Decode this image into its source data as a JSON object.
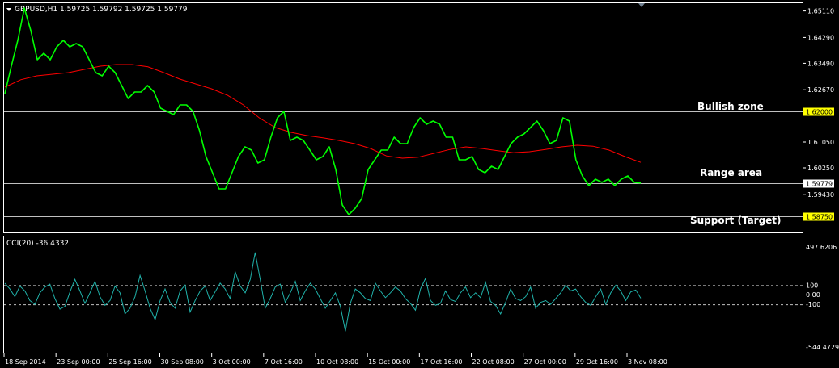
{
  "header": {
    "symbol_line": "GBPUSD,H1  1.59725 1.59792 1.59725 1.59779"
  },
  "annotations": {
    "bullish": "Bullish zone",
    "range": "Range area",
    "support": "Support (Target)"
  },
  "levels": [
    {
      "value": 1.62,
      "label": "1.62000",
      "highlight": true
    },
    {
      "value": 1.59779,
      "label": "1.59779",
      "highlight": false
    },
    {
      "value": 1.5875,
      "label": "1.58750",
      "highlight": true
    }
  ],
  "colors": {
    "background": "#000000",
    "price": "#00FF00",
    "ma": "#FF0000",
    "cci": "#20B2AA",
    "grid_line": "#C0C0C0",
    "level_highlight": "#FFFF00",
    "text": "#FFFFFF"
  },
  "chart_data": [
    {
      "type": "line",
      "title": "GBPUSD,H1",
      "ylim": [
        1.5825,
        1.6535
      ],
      "y_ticks": [
        "1.65110",
        "1.64290",
        "1.63490",
        "1.62670",
        "1.61050",
        "1.60250",
        "1.59430"
      ],
      "x_ticks": [
        "18 Sep 2014",
        "23 Sep 00:00",
        "25 Sep 16:00",
        "30 Sep 08:00",
        "3 Oct 00:00",
        "7 Oct 16:00",
        "10 Oct 08:00",
        "15 Oct 00:00",
        "17 Oct 16:00",
        "22 Oct 08:00",
        "27 Oct 00:00",
        "29 Oct 16:00",
        "3 Nov 08:00"
      ],
      "series": [
        {
          "style": "price",
          "values": [
            1.6255,
            1.634,
            1.642,
            1.652,
            1.645,
            1.636,
            1.638,
            1.636,
            1.64,
            1.642,
            1.64,
            1.641,
            1.64,
            1.636,
            1.632,
            1.631,
            1.634,
            1.632,
            1.628,
            1.624,
            1.626,
            1.626,
            1.628,
            1.626,
            1.621,
            1.62,
            1.619,
            1.622,
            1.622,
            1.62,
            1.614,
            1.606,
            1.601,
            1.596,
            1.596,
            1.601,
            1.606,
            1.609,
            1.608,
            1.604,
            1.605,
            1.612,
            1.618,
            1.62,
            1.611,
            1.612,
            1.611,
            1.608,
            1.605,
            1.606,
            1.609,
            1.602,
            1.591,
            1.588,
            1.59,
            1.593,
            1.602,
            1.605,
            1.608,
            1.608,
            1.612,
            1.61,
            1.61,
            1.615,
            1.618,
            1.616,
            1.617,
            1.616,
            1.612,
            1.612,
            1.605,
            1.605,
            1.606,
            1.602,
            1.601,
            1.603,
            1.602,
            1.606,
            1.61,
            1.612,
            1.613,
            1.615,
            1.617,
            1.614,
            1.61,
            1.611,
            1.618,
            1.617,
            1.605,
            1.6,
            1.597,
            1.599,
            1.598,
            1.599,
            1.597,
            1.599,
            1.6,
            1.598,
            1.5978
          ]
        },
        {
          "style": "ma",
          "values": [
            1.6275,
            1.6298,
            1.631,
            1.6315,
            1.632,
            1.633,
            1.634,
            1.6345,
            1.6345,
            1.6338,
            1.632,
            1.63,
            1.6285,
            1.627,
            1.625,
            1.622,
            1.618,
            1.615,
            1.6135,
            1.6125,
            1.6118,
            1.611,
            1.61,
            1.6085,
            1.6062,
            1.6055,
            1.6058,
            1.607,
            1.6082,
            1.609,
            1.6085,
            1.6078,
            1.6072,
            1.6075,
            1.6082,
            1.609,
            1.6095,
            1.6092,
            1.608,
            1.606,
            1.6042
          ]
        }
      ]
    },
    {
      "type": "line",
      "title": "CCI(20) -36.4332",
      "ylim": [
        -544.4729,
        497.6206
      ],
      "y_ticks": [
        "497.6206",
        "100",
        "0.00",
        "-100",
        "-544.4729"
      ],
      "series": [
        {
          "style": "cci",
          "values": [
            120,
            60,
            -20,
            90,
            40,
            -60,
            -100,
            20,
            80,
            110,
            -40,
            -150,
            -120,
            30,
            160,
            40,
            -90,
            20,
            140,
            -20,
            -110,
            -60,
            90,
            20,
            -200,
            -140,
            -20,
            200,
            40,
            -140,
            -260,
            -60,
            60,
            -80,
            -140,
            40,
            100,
            -180,
            -60,
            40,
            90,
            -60,
            30,
            120,
            60,
            -40,
            240,
            90,
            20,
            160,
            440,
            160,
            -140,
            -40,
            80,
            110,
            -80,
            20,
            140,
            -60,
            40,
            120,
            60,
            -40,
            -140,
            -60,
            20,
            -120,
            -380,
            -90,
            60,
            20,
            -40,
            -60,
            120,
            40,
            -30,
            20,
            80,
            40,
            -40,
            -90,
            -160,
            60,
            170,
            -60,
            -110,
            -90,
            40,
            -50,
            -70,
            20,
            80,
            -30,
            20,
            -30,
            130,
            -70,
            -110,
            -200,
            -80,
            60,
            -40,
            -60,
            -20,
            80,
            -140,
            -80,
            -60,
            -100,
            -40,
            20,
            100,
            40,
            60,
            -20,
            -80,
            -110,
            -20,
            60,
            -100,
            20,
            100,
            40,
            -60,
            30,
            50,
            -36
          ]
        }
      ]
    }
  ]
}
